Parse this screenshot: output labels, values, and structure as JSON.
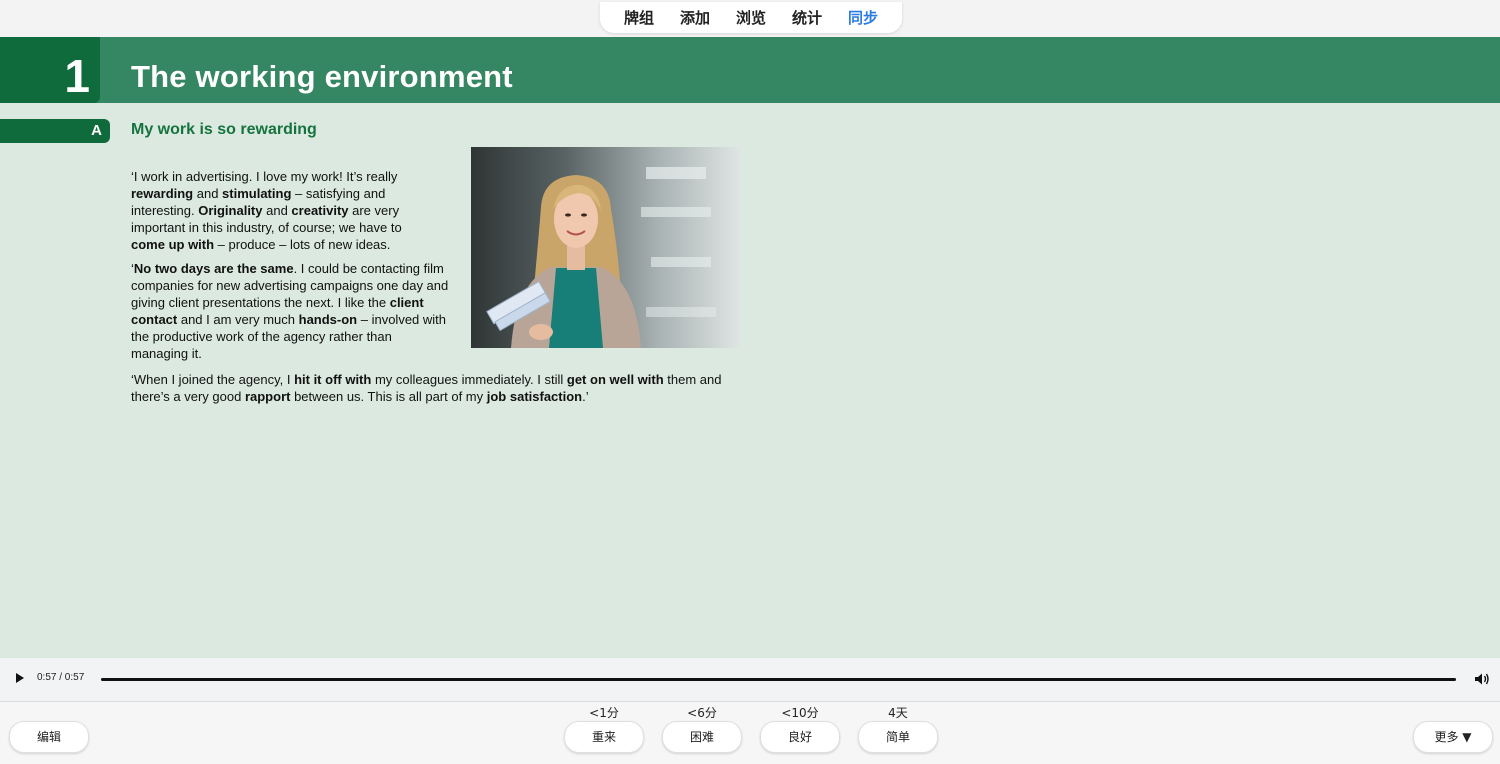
{
  "nav": {
    "items": [
      "牌组",
      "添加",
      "浏览",
      "统计",
      "同步"
    ],
    "active_index": 4
  },
  "card": {
    "chapter_number": "1",
    "chapter_title": "The working environment",
    "section_letter": "A",
    "section_title": "My work is so rewarding",
    "photo_icon": "woman-portrait-photo"
  },
  "audio": {
    "time": "0:57 / 0:57",
    "progress": 1.0
  },
  "answers": [
    {
      "interval": "<1分",
      "label": "重来"
    },
    {
      "interval": "<6分",
      "label": "困难"
    },
    {
      "interval": "<10分",
      "label": "良好"
    },
    {
      "interval": "4天",
      "label": "简单"
    }
  ],
  "bottom": {
    "edit_label": "编辑",
    "more_label": "更多 ▼"
  },
  "colors": {
    "chapter_bar": "#358662",
    "chapter_dark": "#0f6b3c",
    "card_bg": "#dbe9e0",
    "nav_active": "#2b7be0"
  }
}
